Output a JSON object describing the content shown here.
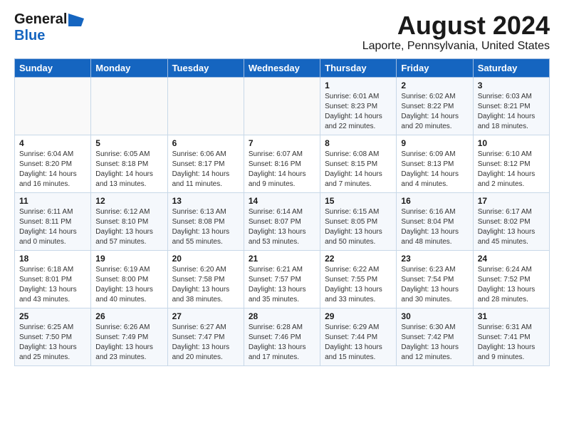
{
  "header": {
    "logo_line1": "General",
    "logo_line2": "Blue",
    "title": "August 2024",
    "subtitle": "Laporte, Pennsylvania, United States"
  },
  "weekdays": [
    "Sunday",
    "Monday",
    "Tuesday",
    "Wednesday",
    "Thursday",
    "Friday",
    "Saturday"
  ],
  "weeks": [
    [
      {
        "day": "",
        "info": ""
      },
      {
        "day": "",
        "info": ""
      },
      {
        "day": "",
        "info": ""
      },
      {
        "day": "",
        "info": ""
      },
      {
        "day": "1",
        "info": "Sunrise: 6:01 AM\nSunset: 8:23 PM\nDaylight: 14 hours\nand 22 minutes."
      },
      {
        "day": "2",
        "info": "Sunrise: 6:02 AM\nSunset: 8:22 PM\nDaylight: 14 hours\nand 20 minutes."
      },
      {
        "day": "3",
        "info": "Sunrise: 6:03 AM\nSunset: 8:21 PM\nDaylight: 14 hours\nand 18 minutes."
      }
    ],
    [
      {
        "day": "4",
        "info": "Sunrise: 6:04 AM\nSunset: 8:20 PM\nDaylight: 14 hours\nand 16 minutes."
      },
      {
        "day": "5",
        "info": "Sunrise: 6:05 AM\nSunset: 8:18 PM\nDaylight: 14 hours\nand 13 minutes."
      },
      {
        "day": "6",
        "info": "Sunrise: 6:06 AM\nSunset: 8:17 PM\nDaylight: 14 hours\nand 11 minutes."
      },
      {
        "day": "7",
        "info": "Sunrise: 6:07 AM\nSunset: 8:16 PM\nDaylight: 14 hours\nand 9 minutes."
      },
      {
        "day": "8",
        "info": "Sunrise: 6:08 AM\nSunset: 8:15 PM\nDaylight: 14 hours\nand 7 minutes."
      },
      {
        "day": "9",
        "info": "Sunrise: 6:09 AM\nSunset: 8:13 PM\nDaylight: 14 hours\nand 4 minutes."
      },
      {
        "day": "10",
        "info": "Sunrise: 6:10 AM\nSunset: 8:12 PM\nDaylight: 14 hours\nand 2 minutes."
      }
    ],
    [
      {
        "day": "11",
        "info": "Sunrise: 6:11 AM\nSunset: 8:11 PM\nDaylight: 14 hours\nand 0 minutes."
      },
      {
        "day": "12",
        "info": "Sunrise: 6:12 AM\nSunset: 8:10 PM\nDaylight: 13 hours\nand 57 minutes."
      },
      {
        "day": "13",
        "info": "Sunrise: 6:13 AM\nSunset: 8:08 PM\nDaylight: 13 hours\nand 55 minutes."
      },
      {
        "day": "14",
        "info": "Sunrise: 6:14 AM\nSunset: 8:07 PM\nDaylight: 13 hours\nand 53 minutes."
      },
      {
        "day": "15",
        "info": "Sunrise: 6:15 AM\nSunset: 8:05 PM\nDaylight: 13 hours\nand 50 minutes."
      },
      {
        "day": "16",
        "info": "Sunrise: 6:16 AM\nSunset: 8:04 PM\nDaylight: 13 hours\nand 48 minutes."
      },
      {
        "day": "17",
        "info": "Sunrise: 6:17 AM\nSunset: 8:02 PM\nDaylight: 13 hours\nand 45 minutes."
      }
    ],
    [
      {
        "day": "18",
        "info": "Sunrise: 6:18 AM\nSunset: 8:01 PM\nDaylight: 13 hours\nand 43 minutes."
      },
      {
        "day": "19",
        "info": "Sunrise: 6:19 AM\nSunset: 8:00 PM\nDaylight: 13 hours\nand 40 minutes."
      },
      {
        "day": "20",
        "info": "Sunrise: 6:20 AM\nSunset: 7:58 PM\nDaylight: 13 hours\nand 38 minutes."
      },
      {
        "day": "21",
        "info": "Sunrise: 6:21 AM\nSunset: 7:57 PM\nDaylight: 13 hours\nand 35 minutes."
      },
      {
        "day": "22",
        "info": "Sunrise: 6:22 AM\nSunset: 7:55 PM\nDaylight: 13 hours\nand 33 minutes."
      },
      {
        "day": "23",
        "info": "Sunrise: 6:23 AM\nSunset: 7:54 PM\nDaylight: 13 hours\nand 30 minutes."
      },
      {
        "day": "24",
        "info": "Sunrise: 6:24 AM\nSunset: 7:52 PM\nDaylight: 13 hours\nand 28 minutes."
      }
    ],
    [
      {
        "day": "25",
        "info": "Sunrise: 6:25 AM\nSunset: 7:50 PM\nDaylight: 13 hours\nand 25 minutes."
      },
      {
        "day": "26",
        "info": "Sunrise: 6:26 AM\nSunset: 7:49 PM\nDaylight: 13 hours\nand 23 minutes."
      },
      {
        "day": "27",
        "info": "Sunrise: 6:27 AM\nSunset: 7:47 PM\nDaylight: 13 hours\nand 20 minutes."
      },
      {
        "day": "28",
        "info": "Sunrise: 6:28 AM\nSunset: 7:46 PM\nDaylight: 13 hours\nand 17 minutes."
      },
      {
        "day": "29",
        "info": "Sunrise: 6:29 AM\nSunset: 7:44 PM\nDaylight: 13 hours\nand 15 minutes."
      },
      {
        "day": "30",
        "info": "Sunrise: 6:30 AM\nSunset: 7:42 PM\nDaylight: 13 hours\nand 12 minutes."
      },
      {
        "day": "31",
        "info": "Sunrise: 6:31 AM\nSunset: 7:41 PM\nDaylight: 13 hours\nand 9 minutes."
      }
    ]
  ]
}
